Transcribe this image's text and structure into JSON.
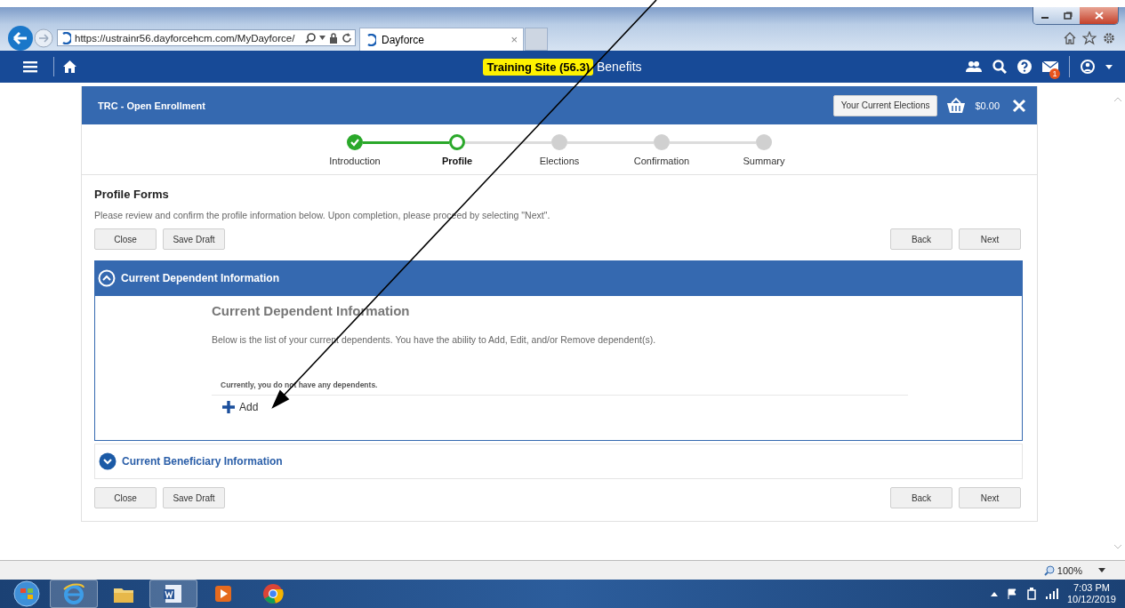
{
  "browser": {
    "address": "https://ustrainr56.dayforcehcm.com/MyDayforce/",
    "tab_title": "Dayforce",
    "tab_close": "×"
  },
  "nav": {
    "site_badge": "Training Site (56.3)",
    "title": "Benefits",
    "mail_count": "1"
  },
  "card": {
    "title": "TRC - Open Enrollment",
    "elections_button": "Your Current Elections",
    "total": "$0.00"
  },
  "steps": [
    {
      "label": "Introduction",
      "completed": true,
      "selected": false
    },
    {
      "label": "Profile",
      "completed": false,
      "selected": true
    },
    {
      "label": "Elections",
      "completed": false,
      "selected": false
    },
    {
      "label": "Confirmation",
      "completed": false,
      "selected": false
    },
    {
      "label": "Summary",
      "completed": false,
      "selected": false
    }
  ],
  "section": {
    "title": "Profile Forms",
    "instructions": "Please review and confirm the profile information below. Upon completion, please proceed by selecting \"Next\"."
  },
  "buttons_top": {
    "left": [
      "Close",
      "Save Draft"
    ],
    "right": [
      "Back",
      "Next"
    ]
  },
  "accordions": [
    {
      "title": "Current Dependent Information",
      "expanded": true,
      "heading": "Current Dependent Information",
      "description": "Below is the list of your current dependents. You have the ability to Add, Edit, and/or Remove dependent(s).",
      "empty_message": "Currently, you do not have any dependents.",
      "add_label": "Add"
    },
    {
      "title": "Current Beneficiary Information",
      "expanded": false
    }
  ],
  "buttons_bottom": {
    "left": [
      "Close",
      "Save Draft"
    ],
    "right": [
      "Back",
      "Next"
    ]
  },
  "status_bar": {
    "zoom": "100%"
  },
  "taskbar": {
    "time": "7:03 PM",
    "date": "10/12/2019"
  }
}
